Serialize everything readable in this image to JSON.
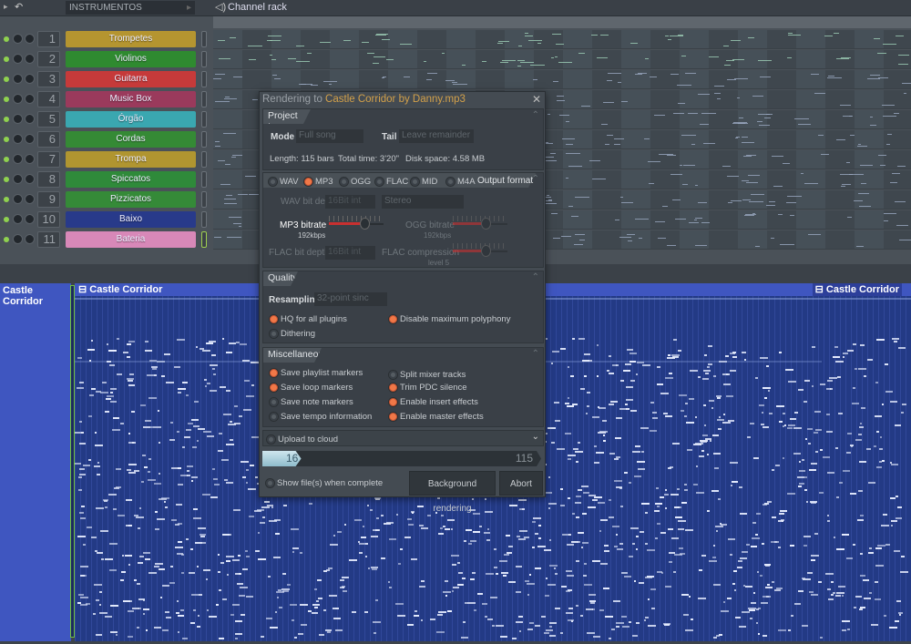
{
  "topbar": {
    "browser_label": "INSTRUMENTOS",
    "window_title": "Channel rack"
  },
  "channels": [
    {
      "num": "1",
      "name": "Trompetes",
      "color": "#b59530"
    },
    {
      "num": "2",
      "name": "Violinos",
      "color": "#2f8a30"
    },
    {
      "num": "3",
      "name": "Guitarra",
      "color": "#c63a3a"
    },
    {
      "num": "4",
      "name": "Music Box",
      "color": "#9a3a5c"
    },
    {
      "num": "5",
      "name": "Órgão",
      "color": "#3aa7b0"
    },
    {
      "num": "6",
      "name": "Cordas",
      "color": "#358a35"
    },
    {
      "num": "7",
      "name": "Trompa",
      "color": "#b09530"
    },
    {
      "num": "8",
      "name": "Spiccatos",
      "color": "#2f8a3a"
    },
    {
      "num": "9",
      "name": "Pizzicatos",
      "color": "#358a38"
    },
    {
      "num": "10",
      "name": "Baixo",
      "color": "#283a8a"
    },
    {
      "num": "11",
      "name": "Bateria",
      "color": "#d888b8"
    }
  ],
  "rack": {
    "add_label": "+"
  },
  "playlist": {
    "track_name": "Castle Corridor",
    "clip_name": "Castle Corridor",
    "clip_name_end": "Castle Corridor"
  },
  "dialog": {
    "title_prefix": "Rendering to ",
    "title_file": "Castle Corridor by Danny.mp3",
    "project_type": {
      "header": "Project type",
      "mode_label": "Mode",
      "mode_value": "Full song",
      "tail_label": "Tail",
      "tail_value": "Leave remainder",
      "length": "Length: 115 bars",
      "total_time": "Total time: 3'20\"",
      "disk_space": "Disk space: 4.58 MB"
    },
    "output": {
      "header": "Output format",
      "formats": [
        {
          "label": "WAV",
          "on": false
        },
        {
          "label": "MP3",
          "on": true
        },
        {
          "label": "OGG",
          "on": false
        },
        {
          "label": "FLAC",
          "on": false
        },
        {
          "label": "MID",
          "on": false
        },
        {
          "label": "M4A",
          "on": false
        }
      ],
      "wav_bit_depth_label": "WAV bit depth",
      "wav_bit_depth_value": "16Bit int",
      "channels_value": "Stereo",
      "mp3_bitrate_label": "MP3 bitrate",
      "mp3_bitrate_value": "192kbps",
      "mp3_bitrate_level": 0.65,
      "ogg_bitrate_label": "OGG bitrate",
      "ogg_bitrate_value": "192kbps",
      "ogg_bitrate_level": 0.6,
      "flac_bit_depth_label": "FLAC bit depth",
      "flac_bit_depth_value": "16Bit int",
      "flac_compression_label": "FLAC compression",
      "flac_compression_value": "level 5",
      "flac_compression_level": 0.6
    },
    "quality": {
      "header": "Quality",
      "resampling_label": "Resampling",
      "resampling_value": "32-point sinc",
      "options": [
        {
          "label": "HQ for all plugins",
          "on": true
        },
        {
          "label": "Disable maximum polyphony",
          "on": true
        },
        {
          "label": "Dithering",
          "on": false
        }
      ]
    },
    "misc": {
      "header": "Miscellaneous",
      "options": [
        {
          "label": "Save playlist markers",
          "on": true
        },
        {
          "label": "Split mixer tracks",
          "on": false
        },
        {
          "label": "Save loop markers",
          "on": true
        },
        {
          "label": "Trim PDC silence",
          "on": true
        },
        {
          "label": "Save note markers",
          "on": false
        },
        {
          "label": "Enable insert effects",
          "on": true
        },
        {
          "label": "Save tempo information",
          "on": false
        },
        {
          "label": "Enable master effects",
          "on": true
        }
      ]
    },
    "upload_label": "Upload to cloud",
    "progress": {
      "current": "16",
      "total": "115"
    },
    "show_files_label": "Show file(s) when complete",
    "background_button": "Background rendering",
    "abort_button": "Abort"
  }
}
